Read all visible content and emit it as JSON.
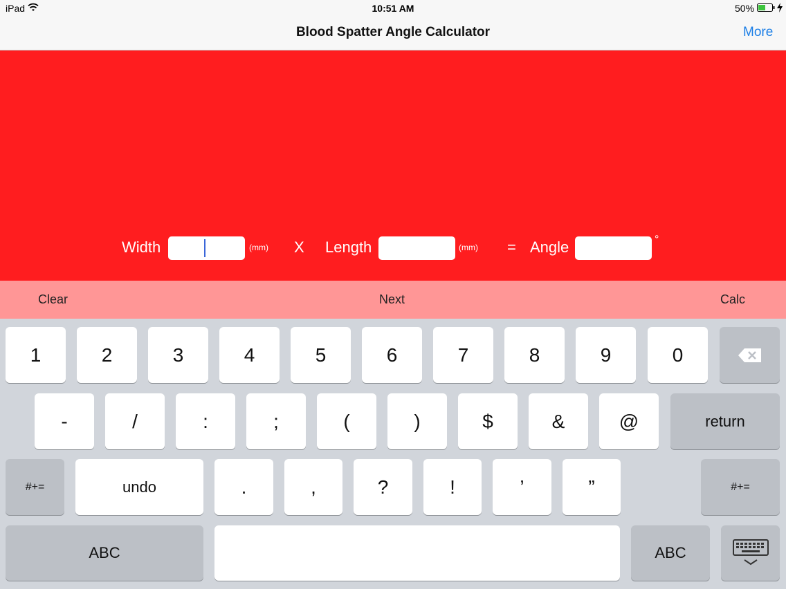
{
  "status": {
    "device": "iPad",
    "time": "10:51 AM",
    "battery_pct": "50%"
  },
  "nav": {
    "title": "Blood Spatter Angle Calculator",
    "more": "More"
  },
  "form": {
    "width_label": "Width",
    "width_unit": "(mm)",
    "times": "X",
    "length_label": "Length",
    "length_unit": "(mm)",
    "equals": "=",
    "angle_label": "Angle",
    "degree": "°",
    "width_value": "",
    "length_value": "",
    "angle_value": ""
  },
  "toolbar": {
    "clear": "Clear",
    "next": "Next",
    "calc": "Calc"
  },
  "keyboard": {
    "row1": [
      "1",
      "2",
      "3",
      "4",
      "5",
      "6",
      "7",
      "8",
      "9",
      "0"
    ],
    "row2": [
      "-",
      "/",
      ":",
      ";",
      "(",
      ")",
      "$",
      "&",
      "@"
    ],
    "return": "return",
    "symbols": "#+=",
    "undo": "undo",
    "row3": [
      ".",
      ",",
      "?",
      "!",
      "’",
      "”"
    ],
    "abc": "ABC"
  },
  "colors": {
    "panel": "#ff1d1f",
    "toolbar": "#ff9696",
    "link": "#1a7ee6"
  }
}
